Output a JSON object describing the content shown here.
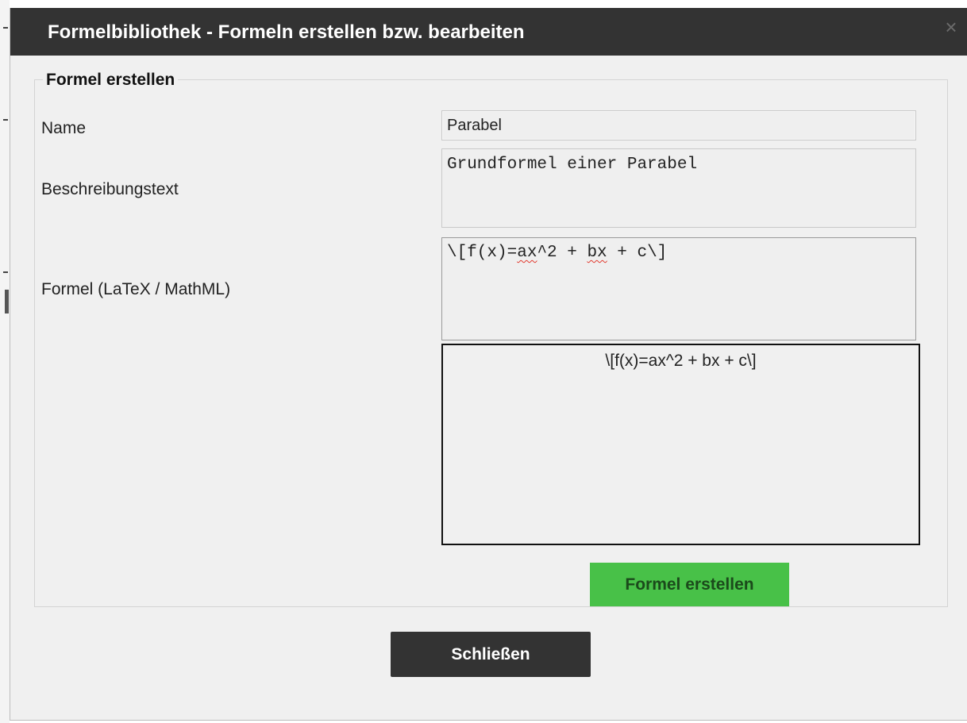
{
  "dialog": {
    "title": "Formelbibliothek - Formeln erstellen bzw. bearbeiten",
    "close_icon": "×"
  },
  "form": {
    "legend": "Formel erstellen",
    "name_label": "Name",
    "name_value": "Parabel",
    "description_label": "Beschreibungstext",
    "description_value": "Grundformel einer Parabel",
    "formula_label": "Formel (LaTeX / MathML)",
    "formula_parts": {
      "part1": "\\[f(x)=",
      "part2": "ax",
      "part3": "^2 + ",
      "part4": "bx",
      "part5": " + c\\]"
    },
    "preview_text": "\\[f(x)=ax^2 + bx + c\\]",
    "create_button": "Formel erstellen"
  },
  "footer": {
    "close_button": "Schließen"
  },
  "colors": {
    "titlebar": "#333333",
    "create_button": "#48c148",
    "close_button": "#333333",
    "dialog_bg": "#f0f0f0"
  },
  "icons": {
    "close": "close-icon"
  }
}
